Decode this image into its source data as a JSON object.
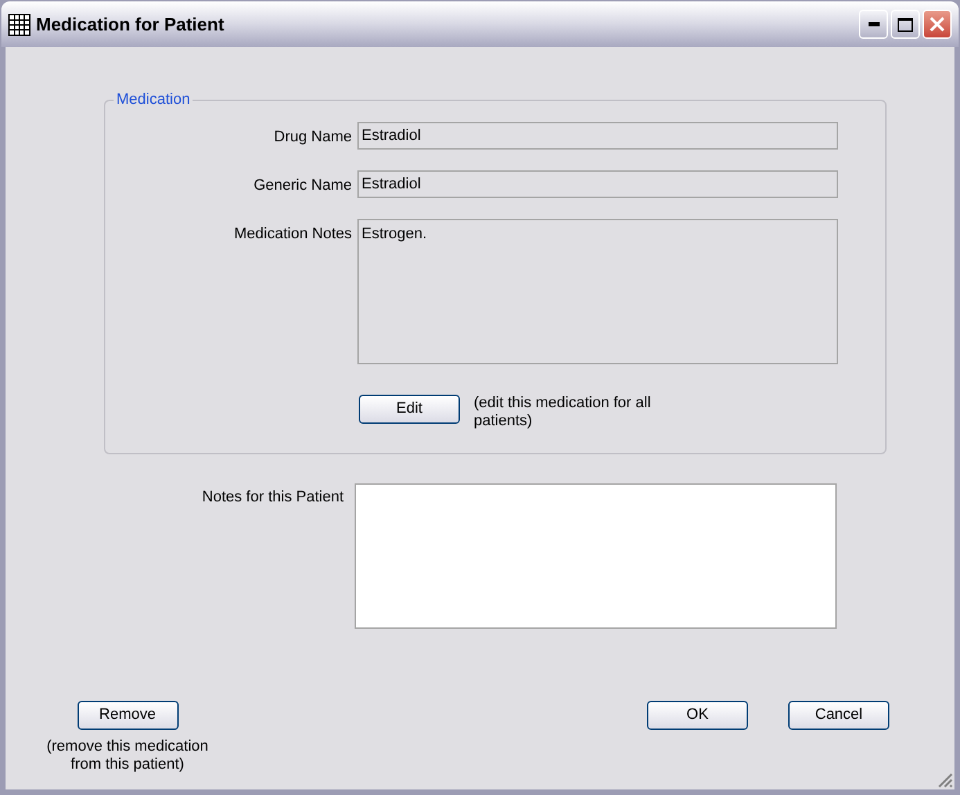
{
  "window": {
    "title": "Medication for Patient"
  },
  "medication": {
    "legend": "Medication",
    "fields": [
      {
        "label": "Drug Name",
        "value": "Estradiol",
        "kind": "line"
      },
      {
        "label": "Generic Name",
        "value": "Estradiol",
        "kind": "line"
      },
      {
        "label": "Medication Notes",
        "value": "Estrogen.",
        "kind": "area"
      }
    ],
    "edit_button": "Edit",
    "edit_note": "(edit this medication for all patients)"
  },
  "patient_notes": {
    "label": "Notes for this Patient"
  },
  "remove_button": "Remove",
  "remove_note": "(remove this medication from this patient)",
  "buttons": [
    "OK",
    "Cancel"
  ]
}
